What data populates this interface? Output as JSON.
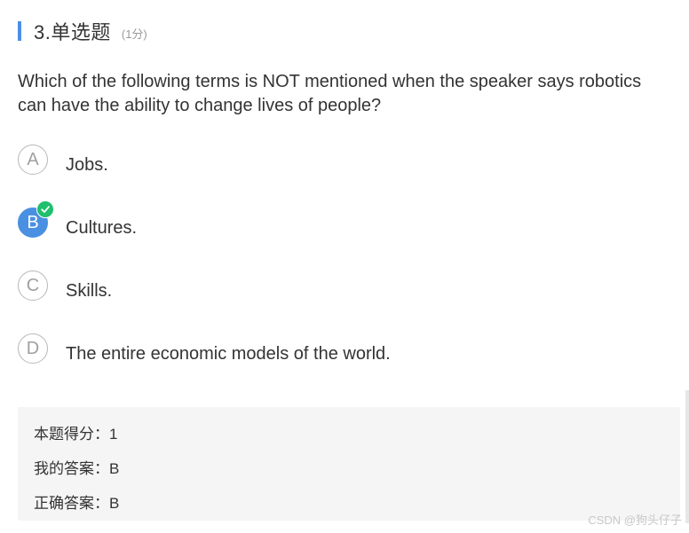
{
  "question": {
    "number_title": "3.单选题",
    "score_note": "(1分)",
    "stem": "Which of the following terms is NOT mentioned when the speaker says robotics can have the ability to change lives of people?"
  },
  "options": [
    {
      "letter": "A",
      "text": "Jobs.",
      "selected": false
    },
    {
      "letter": "B",
      "text": "Cultures.",
      "selected": true
    },
    {
      "letter": "C",
      "text": "Skills.",
      "selected": false
    },
    {
      "letter": "D",
      "text": "The entire economic models of the world.",
      "selected": false
    }
  ],
  "result": {
    "score_line": "本题得分：1",
    "my_answer_line": "我的答案：B",
    "correct_answer_line": "正确答案：B"
  },
  "watermark": "CSDN @狗头仔子",
  "colors": {
    "accent": "#4a90e2",
    "correct_check": "#1fbf6c",
    "result_bg": "#f5f5f5"
  },
  "icons": {
    "selected_badge": "checkmark-icon"
  }
}
